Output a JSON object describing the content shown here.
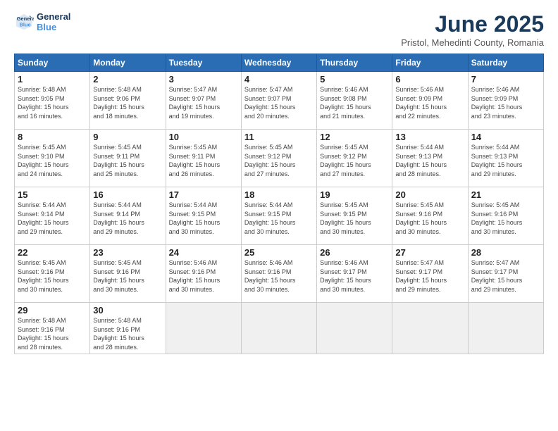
{
  "logo": {
    "line1": "General",
    "line2": "Blue"
  },
  "title": "June 2025",
  "location": "Pristol, Mehedinti County, Romania",
  "headers": [
    "Sunday",
    "Monday",
    "Tuesday",
    "Wednesday",
    "Thursday",
    "Friday",
    "Saturday"
  ],
  "days": [
    {
      "num": "",
      "info": ""
    },
    {
      "num": "",
      "info": ""
    },
    {
      "num": "",
      "info": ""
    },
    {
      "num": "",
      "info": ""
    },
    {
      "num": "",
      "info": ""
    },
    {
      "num": "",
      "info": ""
    },
    {
      "num": "1",
      "info": "Sunrise: 5:48 AM\nSunset: 9:05 PM\nDaylight: 15 hours\nand 16 minutes."
    },
    {
      "num": "2",
      "info": "Sunrise: 5:48 AM\nSunset: 9:06 PM\nDaylight: 15 hours\nand 18 minutes."
    },
    {
      "num": "3",
      "info": "Sunrise: 5:47 AM\nSunset: 9:07 PM\nDaylight: 15 hours\nand 19 minutes."
    },
    {
      "num": "4",
      "info": "Sunrise: 5:47 AM\nSunset: 9:07 PM\nDaylight: 15 hours\nand 20 minutes."
    },
    {
      "num": "5",
      "info": "Sunrise: 5:46 AM\nSunset: 9:08 PM\nDaylight: 15 hours\nand 21 minutes."
    },
    {
      "num": "6",
      "info": "Sunrise: 5:46 AM\nSunset: 9:09 PM\nDaylight: 15 hours\nand 22 minutes."
    },
    {
      "num": "7",
      "info": "Sunrise: 5:46 AM\nSunset: 9:09 PM\nDaylight: 15 hours\nand 23 minutes."
    },
    {
      "num": "8",
      "info": "Sunrise: 5:45 AM\nSunset: 9:10 PM\nDaylight: 15 hours\nand 24 minutes."
    },
    {
      "num": "9",
      "info": "Sunrise: 5:45 AM\nSunset: 9:11 PM\nDaylight: 15 hours\nand 25 minutes."
    },
    {
      "num": "10",
      "info": "Sunrise: 5:45 AM\nSunset: 9:11 PM\nDaylight: 15 hours\nand 26 minutes."
    },
    {
      "num": "11",
      "info": "Sunrise: 5:45 AM\nSunset: 9:12 PM\nDaylight: 15 hours\nand 27 minutes."
    },
    {
      "num": "12",
      "info": "Sunrise: 5:45 AM\nSunset: 9:12 PM\nDaylight: 15 hours\nand 27 minutes."
    },
    {
      "num": "13",
      "info": "Sunrise: 5:44 AM\nSunset: 9:13 PM\nDaylight: 15 hours\nand 28 minutes."
    },
    {
      "num": "14",
      "info": "Sunrise: 5:44 AM\nSunset: 9:13 PM\nDaylight: 15 hours\nand 29 minutes."
    },
    {
      "num": "15",
      "info": "Sunrise: 5:44 AM\nSunset: 9:14 PM\nDaylight: 15 hours\nand 29 minutes."
    },
    {
      "num": "16",
      "info": "Sunrise: 5:44 AM\nSunset: 9:14 PM\nDaylight: 15 hours\nand 29 minutes."
    },
    {
      "num": "17",
      "info": "Sunrise: 5:44 AM\nSunset: 9:15 PM\nDaylight: 15 hours\nand 30 minutes."
    },
    {
      "num": "18",
      "info": "Sunrise: 5:44 AM\nSunset: 9:15 PM\nDaylight: 15 hours\nand 30 minutes."
    },
    {
      "num": "19",
      "info": "Sunrise: 5:45 AM\nSunset: 9:15 PM\nDaylight: 15 hours\nand 30 minutes."
    },
    {
      "num": "20",
      "info": "Sunrise: 5:45 AM\nSunset: 9:16 PM\nDaylight: 15 hours\nand 30 minutes."
    },
    {
      "num": "21",
      "info": "Sunrise: 5:45 AM\nSunset: 9:16 PM\nDaylight: 15 hours\nand 30 minutes."
    },
    {
      "num": "22",
      "info": "Sunrise: 5:45 AM\nSunset: 9:16 PM\nDaylight: 15 hours\nand 30 minutes."
    },
    {
      "num": "23",
      "info": "Sunrise: 5:45 AM\nSunset: 9:16 PM\nDaylight: 15 hours\nand 30 minutes."
    },
    {
      "num": "24",
      "info": "Sunrise: 5:46 AM\nSunset: 9:16 PM\nDaylight: 15 hours\nand 30 minutes."
    },
    {
      "num": "25",
      "info": "Sunrise: 5:46 AM\nSunset: 9:16 PM\nDaylight: 15 hours\nand 30 minutes."
    },
    {
      "num": "26",
      "info": "Sunrise: 5:46 AM\nSunset: 9:17 PM\nDaylight: 15 hours\nand 30 minutes."
    },
    {
      "num": "27",
      "info": "Sunrise: 5:47 AM\nSunset: 9:17 PM\nDaylight: 15 hours\nand 29 minutes."
    },
    {
      "num": "28",
      "info": "Sunrise: 5:47 AM\nSunset: 9:17 PM\nDaylight: 15 hours\nand 29 minutes."
    },
    {
      "num": "29",
      "info": "Sunrise: 5:48 AM\nSunset: 9:16 PM\nDaylight: 15 hours\nand 28 minutes."
    },
    {
      "num": "30",
      "info": "Sunrise: 5:48 AM\nSunset: 9:16 PM\nDaylight: 15 hours\nand 28 minutes."
    },
    {
      "num": "",
      "info": ""
    },
    {
      "num": "",
      "info": ""
    },
    {
      "num": "",
      "info": ""
    },
    {
      "num": "",
      "info": ""
    },
    {
      "num": "",
      "info": ""
    }
  ]
}
